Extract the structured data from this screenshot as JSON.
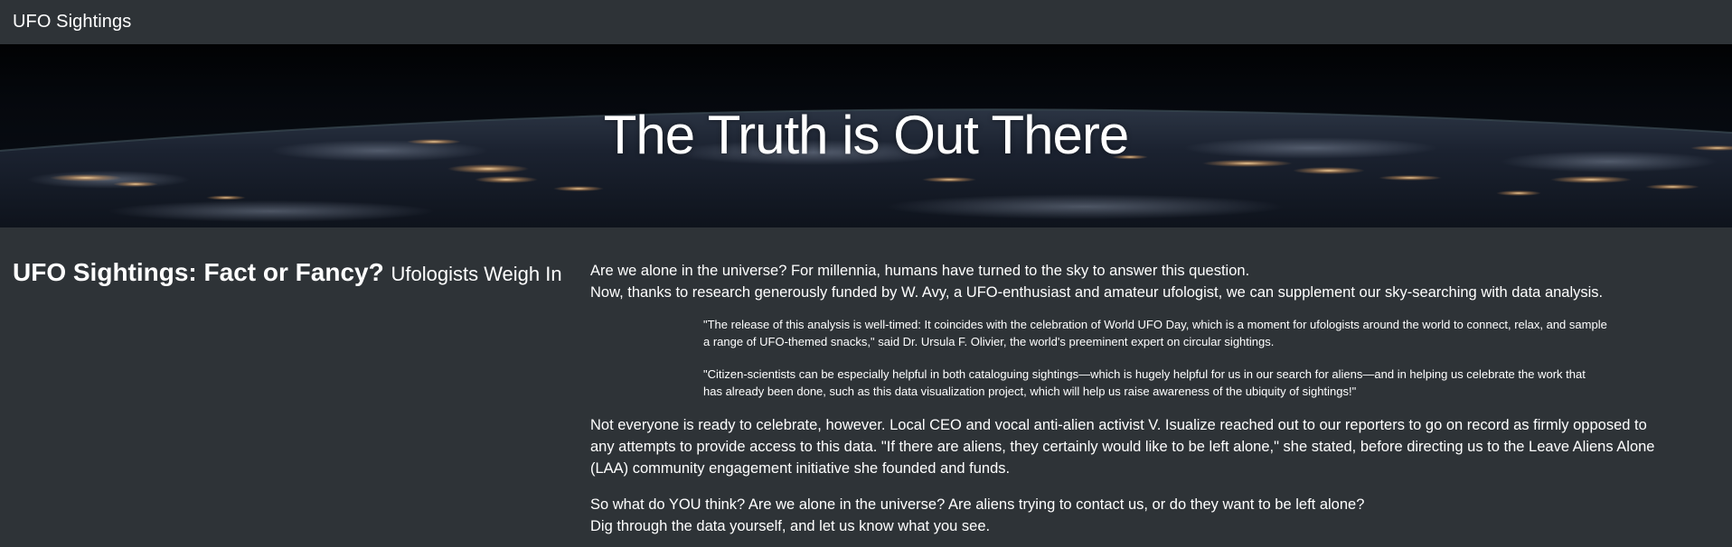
{
  "navbar": {
    "brand": "UFO Sightings"
  },
  "hero": {
    "title": "The Truth is Out There"
  },
  "article": {
    "heading_main": "UFO Sightings: Fact or Fancy?",
    "heading_sub": "Ufologists Weigh In",
    "intro_line_1": "Are we alone in the universe? For millennia, humans have turned to the sky to answer this question.",
    "intro_line_2": "Now, thanks to research generously funded by W. Avy, a UFO-enthusiast and amateur ufologist, we can supplement our sky-searching with data analysis.",
    "quote_1": "\"The release of this analysis is well-timed: It coincides with the celebration of World UFO Day, which is a moment for ufologists around the world to connect, relax, and sample a range of UFO-themed snacks,\" said Dr. Ursula F. Olivier, the world's preeminent expert on circular sightings.",
    "quote_2": "\"Citizen-scientists can be especially helpful in both cataloguing sightings—which is hugely helpful for us in our search for aliens—and in helping us celebrate the work that has already been done, such as this data visualization project, which will help us raise awareness of the ubiquity of sightings!\"",
    "para_2": "Not everyone is ready to celebrate, however. Local CEO and vocal anti-alien activist V. Isualize reached out to our reporters to go on record as firmly opposed to any attempts to provide access to this data. \"If there are aliens, they certainly would like to be left alone,\" she stated, before directing us to the Leave Aliens Alone (LAA) community engagement initiative she founded and funds.",
    "closing_line_1": "So what do YOU think? Are we alone in the universe? Are aliens trying to contact us, or do they want to be left alone?",
    "closing_line_2": "Dig through the data yourself, and let us know what you see."
  },
  "colors": {
    "page_background": "#2e3337",
    "text": "#ffffff"
  }
}
